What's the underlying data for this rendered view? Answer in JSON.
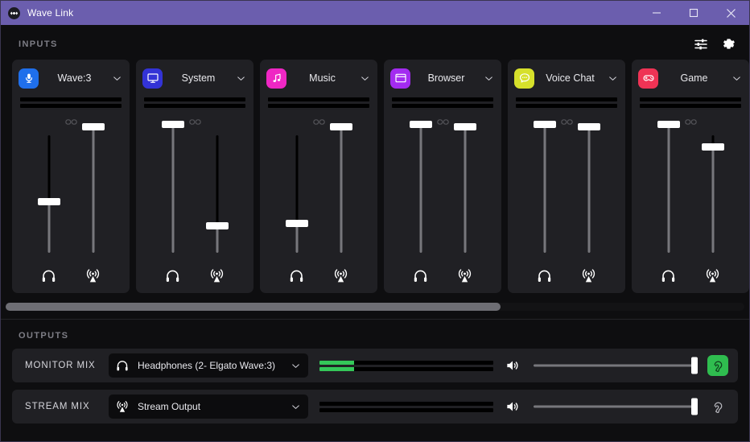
{
  "window": {
    "title": "Wave Link",
    "logo_icon": "wave-link-logo-icon",
    "accent": "#6b5eae",
    "controls": [
      {
        "name": "minimize",
        "icon": "minimize-icon"
      },
      {
        "name": "maximize",
        "icon": "maximize-icon"
      },
      {
        "name": "close",
        "icon": "close-icon"
      }
    ]
  },
  "inputs_section": {
    "label": "INPUTS",
    "toolbar": [
      {
        "name": "mixer-settings",
        "icon": "sliders-icon"
      },
      {
        "name": "preferences",
        "icon": "gear-icon"
      }
    ],
    "channels": [
      {
        "name": "Wave:3",
        "icon": "microphone-icon",
        "color": "#1f6feb",
        "link_icon": "link-broken-icon",
        "linked": false,
        "meters": [
          0,
          0
        ],
        "monitor": {
          "level": 38,
          "icon": "headphones-icon"
        },
        "stream": {
          "level": 93,
          "icon": "broadcast-icon"
        }
      },
      {
        "name": "System",
        "icon": "monitor-icon",
        "color": "#3333d6",
        "link_icon": "link-broken-icon",
        "linked": false,
        "meters": [
          0,
          0
        ],
        "monitor": {
          "level": 95,
          "icon": "headphones-icon"
        },
        "stream": {
          "level": 20,
          "icon": "broadcast-icon"
        }
      },
      {
        "name": "Music",
        "icon": "music-note-icon",
        "color": "#ef27c4",
        "link_icon": "link-broken-icon",
        "linked": false,
        "meters": [
          0,
          0
        ],
        "monitor": {
          "level": 22,
          "icon": "headphones-icon"
        },
        "stream": {
          "level": 93,
          "icon": "broadcast-icon"
        }
      },
      {
        "name": "Browser",
        "icon": "browser-window-icon",
        "color": "#a32bf0",
        "link_icon": "link-broken-icon",
        "linked": false,
        "meters": [
          0,
          0
        ],
        "monitor": {
          "level": 95,
          "icon": "headphones-icon"
        },
        "stream": {
          "level": 93,
          "icon": "broadcast-icon"
        }
      },
      {
        "name": "Voice Chat",
        "icon": "chat-bubble-icon",
        "color": "#d6e02b",
        "link_icon": "link-broken-icon",
        "linked": false,
        "meters": [
          0,
          0
        ],
        "monitor": {
          "level": 95,
          "icon": "headphones-icon"
        },
        "stream": {
          "level": 93,
          "icon": "broadcast-icon"
        }
      },
      {
        "name": "Game",
        "icon": "gamepad-icon",
        "color": "#ef3355",
        "link_icon": "link-broken-icon",
        "linked": false,
        "meters": [
          0,
          0
        ],
        "monitor": {
          "level": 95,
          "icon": "headphones-icon"
        },
        "stream": {
          "level": 78,
          "icon": "broadcast-icon"
        }
      }
    ],
    "scrollbar": {
      "thumb_percent": 67
    }
  },
  "outputs_section": {
    "label": "OUTPUTS",
    "rows": [
      {
        "label": "MONITOR MIX",
        "device": "Headphones (2- Elgato Wave:3)",
        "device_icon": "headphones-icon",
        "caret_icon": "chevron-down-icon",
        "meters": [
          20,
          20
        ],
        "speaker_icon": "speaker-icon",
        "volume": 100,
        "monitor_toggle": {
          "icon": "ear-icon",
          "active": true,
          "color": "#2fbd4f"
        }
      },
      {
        "label": "STREAM MIX",
        "device": "Stream Output",
        "device_icon": "broadcast-icon",
        "caret_icon": "chevron-down-icon",
        "meters": [
          0,
          0
        ],
        "speaker_icon": "speaker-icon",
        "volume": 100,
        "monitor_toggle": {
          "icon": "ear-icon",
          "active": false,
          "color": "#b9b9c0"
        }
      }
    ]
  }
}
